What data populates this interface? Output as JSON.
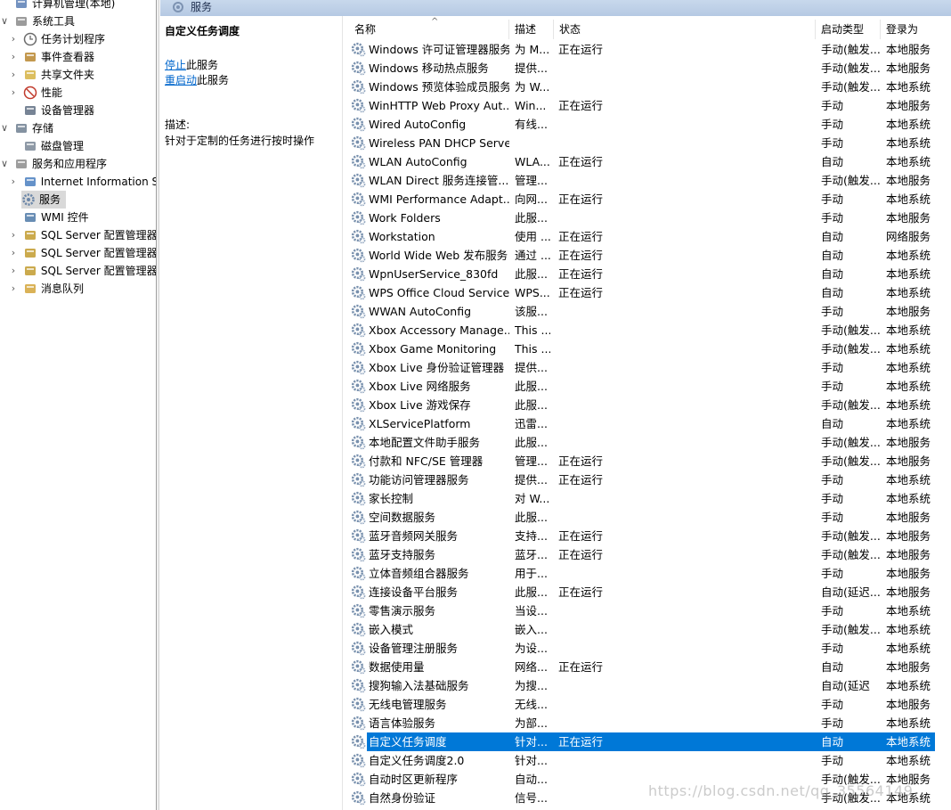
{
  "tree": [
    {
      "label": "计算机管理(本地)",
      "icon": "computer-management-icon",
      "chevron": "",
      "indent": 0,
      "selected": false
    },
    {
      "label": "系统工具",
      "icon": "system-tools-icon",
      "chevron": "∨",
      "indent": 0,
      "selected": false
    },
    {
      "label": "任务计划程序",
      "icon": "clock-icon",
      "chevron": "›",
      "indent": 1,
      "selected": false
    },
    {
      "label": "事件查看器",
      "icon": "event-viewer-icon",
      "chevron": "›",
      "indent": 1,
      "selected": false
    },
    {
      "label": "共享文件夹",
      "icon": "shared-folder-icon",
      "chevron": "›",
      "indent": 1,
      "selected": false
    },
    {
      "label": "性能",
      "icon": "performance-icon",
      "chevron": "›",
      "indent": 1,
      "selected": false
    },
    {
      "label": "设备管理器",
      "icon": "device-manager-icon",
      "chevron": "",
      "indent": 1,
      "selected": false
    },
    {
      "label": "存储",
      "icon": "storage-icon",
      "chevron": "∨",
      "indent": 0,
      "selected": false
    },
    {
      "label": "磁盘管理",
      "icon": "disk-icon",
      "chevron": "",
      "indent": 1,
      "selected": false
    },
    {
      "label": "服务和应用程序",
      "icon": "services-apps-icon",
      "chevron": "∨",
      "indent": 0,
      "selected": false
    },
    {
      "label": "Internet Information S",
      "icon": "iis-icon",
      "chevron": "›",
      "indent": 1,
      "selected": false
    },
    {
      "label": "服务",
      "icon": "gear-icon",
      "chevron": "",
      "indent": 1,
      "selected": true
    },
    {
      "label": "WMI 控件",
      "icon": "wmi-icon",
      "chevron": "",
      "indent": 1,
      "selected": false
    },
    {
      "label": "SQL Server 配置管理器",
      "icon": "sql-server-icon",
      "chevron": "›",
      "indent": 1,
      "selected": false
    },
    {
      "label": "SQL Server 配置管理器",
      "icon": "sql-server-icon",
      "chevron": "›",
      "indent": 1,
      "selected": false
    },
    {
      "label": "SQL Server 配置管理器",
      "icon": "sql-server-icon",
      "chevron": "›",
      "indent": 1,
      "selected": false
    },
    {
      "label": "消息队列",
      "icon": "message-queue-icon",
      "chevron": "›",
      "indent": 1,
      "selected": false
    }
  ],
  "topbar": {
    "title": "服务"
  },
  "detail": {
    "title": "自定义任务调度",
    "stop_link": "停止",
    "stop_suffix": "此服务",
    "restart_link": "重启动",
    "restart_suffix": "此服务",
    "desc_label": "描述:",
    "desc_text": "针对于定制的任务进行按时操作"
  },
  "columns": {
    "name": "名称",
    "desc": "描述",
    "status": "状态",
    "startup": "启动类型",
    "logon": "登录为",
    "sort_indicator": "^"
  },
  "services": [
    {
      "name": "Windows 许可证管理器服务",
      "desc": "为 M...",
      "status": "正在运行",
      "startup": "手动(触发...",
      "logon": "本地服务"
    },
    {
      "name": "Windows 移动热点服务",
      "desc": "提供...",
      "status": "",
      "startup": "手动(触发...",
      "logon": "本地服务"
    },
    {
      "name": "Windows 预览体验成员服务",
      "desc": "为 W...",
      "status": "",
      "startup": "手动(触发...",
      "logon": "本地系统"
    },
    {
      "name": "WinHTTP Web Proxy Aut...",
      "desc": "Win...",
      "status": "正在运行",
      "startup": "手动",
      "logon": "本地服务"
    },
    {
      "name": "Wired AutoConfig",
      "desc": "有线...",
      "status": "",
      "startup": "手动",
      "logon": "本地系统"
    },
    {
      "name": "Wireless PAN DHCP Server",
      "desc": "",
      "status": "",
      "startup": "手动",
      "logon": "本地系统"
    },
    {
      "name": "WLAN AutoConfig",
      "desc": "WLA...",
      "status": "正在运行",
      "startup": "自动",
      "logon": "本地系统"
    },
    {
      "name": "WLAN Direct 服务连接管...",
      "desc": "管理...",
      "status": "",
      "startup": "手动(触发...",
      "logon": "本地服务"
    },
    {
      "name": "WMI Performance Adapt...",
      "desc": "向网...",
      "status": "正在运行",
      "startup": "手动",
      "logon": "本地系统"
    },
    {
      "name": "Work Folders",
      "desc": "此服...",
      "status": "",
      "startup": "手动",
      "logon": "本地服务"
    },
    {
      "name": "Workstation",
      "desc": "使用 ...",
      "status": "正在运行",
      "startup": "自动",
      "logon": "网络服务"
    },
    {
      "name": "World Wide Web 发布服务",
      "desc": "通过 ...",
      "status": "正在运行",
      "startup": "自动",
      "logon": "本地系统"
    },
    {
      "name": "WpnUserService_830fd",
      "desc": "此服...",
      "status": "正在运行",
      "startup": "自动",
      "logon": "本地系统"
    },
    {
      "name": "WPS Office Cloud Service",
      "desc": "WPS...",
      "status": "正在运行",
      "startup": "自动",
      "logon": "本地系统"
    },
    {
      "name": "WWAN AutoConfig",
      "desc": "该服...",
      "status": "",
      "startup": "手动",
      "logon": "本地服务"
    },
    {
      "name": "Xbox Accessory Manage...",
      "desc": "This ...",
      "status": "",
      "startup": "手动(触发...",
      "logon": "本地系统"
    },
    {
      "name": "Xbox Game Monitoring",
      "desc": "This ...",
      "status": "",
      "startup": "手动(触发...",
      "logon": "本地系统"
    },
    {
      "name": "Xbox Live 身份验证管理器",
      "desc": "提供...",
      "status": "",
      "startup": "手动",
      "logon": "本地系统"
    },
    {
      "name": "Xbox Live 网络服务",
      "desc": "此服...",
      "status": "",
      "startup": "手动",
      "logon": "本地系统"
    },
    {
      "name": "Xbox Live 游戏保存",
      "desc": "此服...",
      "status": "",
      "startup": "手动(触发...",
      "logon": "本地系统"
    },
    {
      "name": "XLServicePlatform",
      "desc": "迅雷...",
      "status": "",
      "startup": "自动",
      "logon": "本地系统"
    },
    {
      "name": "本地配置文件助手服务",
      "desc": "此服...",
      "status": "",
      "startup": "手动(触发...",
      "logon": "本地服务"
    },
    {
      "name": "付款和 NFC/SE 管理器",
      "desc": "管理...",
      "status": "正在运行",
      "startup": "手动(触发...",
      "logon": "本地服务"
    },
    {
      "name": "功能访问管理器服务",
      "desc": "提供...",
      "status": "正在运行",
      "startup": "手动",
      "logon": "本地系统"
    },
    {
      "name": "家长控制",
      "desc": "对 W...",
      "status": "",
      "startup": "手动",
      "logon": "本地系统"
    },
    {
      "name": "空间数据服务",
      "desc": "此服...",
      "status": "",
      "startup": "手动",
      "logon": "本地服务"
    },
    {
      "name": "蓝牙音频网关服务",
      "desc": "支持...",
      "status": "正在运行",
      "startup": "手动(触发...",
      "logon": "本地服务"
    },
    {
      "name": "蓝牙支持服务",
      "desc": "蓝牙...",
      "status": "正在运行",
      "startup": "手动(触发...",
      "logon": "本地服务"
    },
    {
      "name": "立体音频组合器服务",
      "desc": "用于...",
      "status": "",
      "startup": "手动",
      "logon": "本地服务"
    },
    {
      "name": "连接设备平台服务",
      "desc": "此服...",
      "status": "正在运行",
      "startup": "自动(延迟...",
      "logon": "本地服务"
    },
    {
      "name": "零售演示服务",
      "desc": "当设...",
      "status": "",
      "startup": "手动",
      "logon": "本地系统"
    },
    {
      "name": "嵌入模式",
      "desc": "嵌入...",
      "status": "",
      "startup": "手动(触发...",
      "logon": "本地系统"
    },
    {
      "name": "设备管理注册服务",
      "desc": "为设...",
      "status": "",
      "startup": "手动",
      "logon": "本地系统"
    },
    {
      "name": "数据使用量",
      "desc": "网络...",
      "status": "正在运行",
      "startup": "自动",
      "logon": "本地服务"
    },
    {
      "name": "搜狗输入法基础服务",
      "desc": "为搜...",
      "status": "",
      "startup": "自动(延迟",
      "logon": "本地系统"
    },
    {
      "name": "无线电管理服务",
      "desc": "无线...",
      "status": "",
      "startup": "手动",
      "logon": "本地服务"
    },
    {
      "name": "语言体验服务",
      "desc": "为部...",
      "status": "",
      "startup": "手动",
      "logon": "本地系统"
    },
    {
      "name": "自定义任务调度",
      "desc": "针对...",
      "status": "正在运行",
      "startup": "自动",
      "logon": "本地系统",
      "selected": true
    },
    {
      "name": "自定义任务调度2.0",
      "desc": "针对...",
      "status": "",
      "startup": "手动",
      "logon": "本地系统"
    },
    {
      "name": "自动时区更新程序",
      "desc": "自动...",
      "status": "",
      "startup": "手动(触发...",
      "logon": "本地服务"
    },
    {
      "name": "自然身份验证",
      "desc": "信号...",
      "status": "",
      "startup": "手动(触发...",
      "logon": "本地系统"
    }
  ],
  "watermark": "https://blog.csdn.net/qq_35564149",
  "colors": {
    "selection": "#0078d7",
    "link": "#0066cc"
  }
}
